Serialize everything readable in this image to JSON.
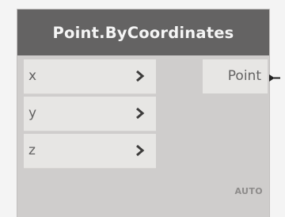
{
  "node": {
    "title": "Point.ByCoordinates",
    "inputs": [
      {
        "label": "x"
      },
      {
        "label": "y"
      },
      {
        "label": "z"
      }
    ],
    "output": {
      "label": "Point"
    },
    "lacing": "AUTO"
  },
  "colors": {
    "header": "#646363",
    "body": "#cfcdcc",
    "port": "#e7e6e4",
    "text": "#646363"
  }
}
